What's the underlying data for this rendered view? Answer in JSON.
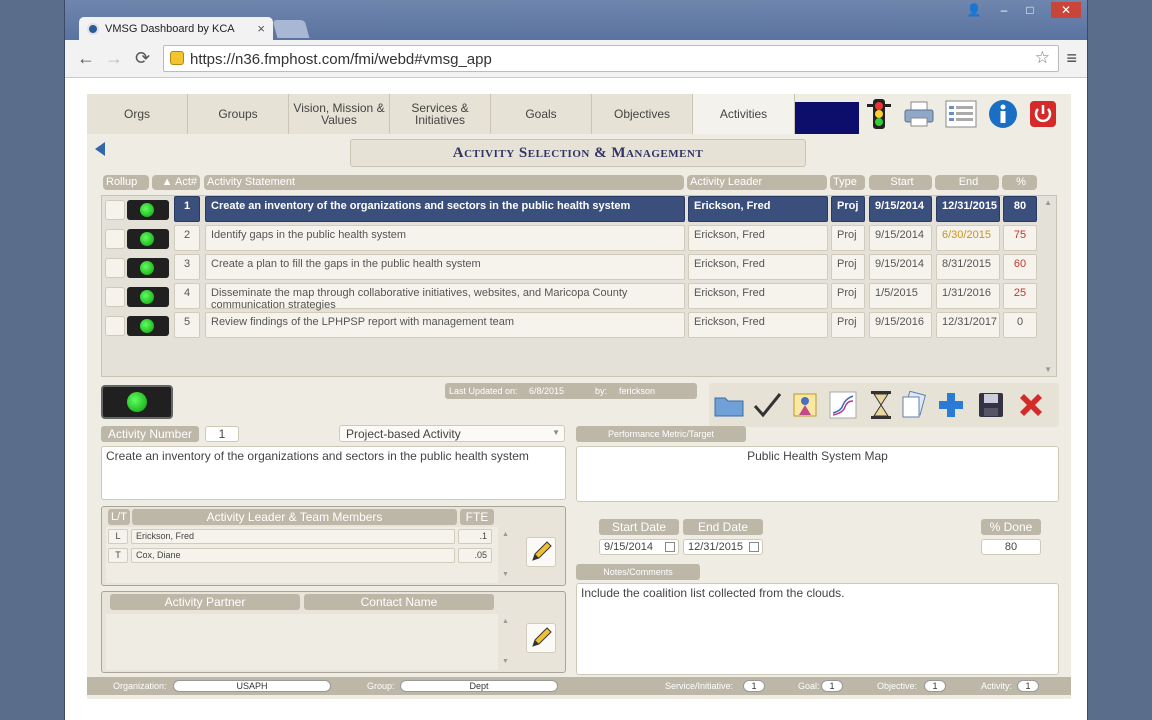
{
  "browser": {
    "tab_title": "VMSG Dashboard by KCA",
    "url_full": "https://n36.fmphost.com/fmi/webd#vmsg_app",
    "controls": {
      "user": "👤",
      "minimize": "–",
      "maximize": "□",
      "close": "✕"
    }
  },
  "nav": {
    "tabs": [
      {
        "label": "Orgs"
      },
      {
        "label": "Groups"
      },
      {
        "label": "Vision, Mission & Values"
      },
      {
        "label": "Services & Initiatives"
      },
      {
        "label": "Goals"
      },
      {
        "label": "Objectives"
      },
      {
        "label": "Activities"
      }
    ],
    "icons": [
      "traffic-light-icon",
      "printer-icon",
      "list-view-icon",
      "info-icon",
      "power-icon"
    ]
  },
  "section_title": "Activity Selection & Management",
  "table": {
    "headers": {
      "rollup": "Rollup",
      "act": "▲ Act#",
      "statement": "Activity Statement",
      "leader": "Activity Leader",
      "type": "Type",
      "start": "Start",
      "end": "End",
      "pct": "%"
    },
    "rows": [
      {
        "num": "1",
        "statement": "Create an inventory of the organizations and sectors in the public health system",
        "leader": "Erickson, Fred",
        "type": "Proj",
        "start": "9/15/2014",
        "end": "12/31/2015",
        "pct": "80"
      },
      {
        "num": "2",
        "statement": "Identify gaps in the public health system",
        "leader": "Erickson, Fred",
        "type": "Proj",
        "start": "9/15/2014",
        "end": "6/30/2015",
        "pct": "75"
      },
      {
        "num": "3",
        "statement": "Create a plan to fill the gaps in the public health system",
        "leader": "Erickson, Fred",
        "type": "Proj",
        "start": "9/15/2014",
        "end": "8/31/2015",
        "pct": "60"
      },
      {
        "num": "4",
        "statement": "Disseminate the map through collaborative initiatives, websites, and Maricopa County communication strategies",
        "leader": "Erickson, Fred",
        "type": "Proj",
        "start": "1/5/2015",
        "end": "1/31/2016",
        "pct": "25"
      },
      {
        "num": "5",
        "statement": "Review findings of the LPHPSP report with management team",
        "leader": "Erickson, Fred",
        "type": "Proj",
        "start": "9/15/2016",
        "end": "12/31/2017",
        "pct": "0"
      }
    ]
  },
  "updated": {
    "label": "Last Updated on:",
    "date": "6/8/2015",
    "by_label": "by:",
    "by": "ferickson"
  },
  "detail": {
    "activity_number_label": "Activity Number",
    "activity_number": "1",
    "type_select": "Project-based Activity",
    "statement": "Create an inventory of the organizations and sectors in the public health system",
    "perf_label": "Performance Metric/Target",
    "perf_value": "Public Health System Map",
    "team_header_lt": "L/T",
    "team_header_name": "Activity Leader & Team Members",
    "team_header_fte": "FTE",
    "team": [
      {
        "role": "L",
        "name": "Erickson, Fred",
        "fte": ".1"
      },
      {
        "role": "T",
        "name": "Cox, Diane",
        "fte": ".05"
      }
    ],
    "start_label": "Start Date",
    "end_label": "End Date",
    "done_label": "% Done",
    "start_date": "9/15/2014",
    "end_date": "12/31/2015",
    "done": "80",
    "notes_label": "Notes/Comments",
    "notes": "Include the coalition list collected from the clouds.",
    "partner_label": "Activity Partner",
    "contact_label": "Contact Name"
  },
  "footer": {
    "org_label": "Organization:",
    "org": "USAPH",
    "group_label": "Group:",
    "group": "Dept",
    "service_label": "Service/Initiative:",
    "service": "1",
    "goal_label": "Goal:",
    "goal": "1",
    "objective_label": "Objective:",
    "objective": "1",
    "activity_label": "Activity:",
    "activity": "1"
  },
  "colors": {
    "accent": "#3b4f7d",
    "pill": "#bdb7a8",
    "panel": "#efece4",
    "overdue_pct": "#c0392b",
    "late_date": "#c8961e"
  }
}
